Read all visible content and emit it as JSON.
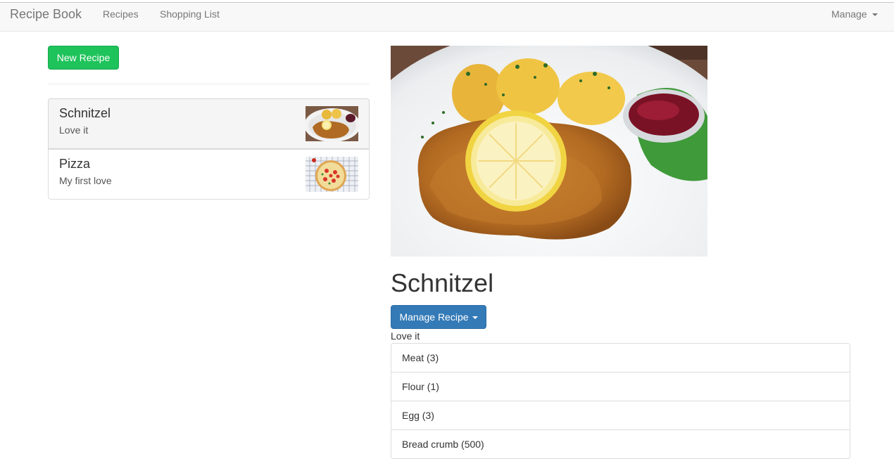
{
  "navbar": {
    "brand": "Recipe Book",
    "links": [
      "Recipes",
      "Shopping List"
    ],
    "manage": "Manage"
  },
  "sidebar": {
    "new_recipe_label": "New Recipe",
    "recipes": [
      {
        "name": "Schnitzel",
        "description": "Love it",
        "active": true,
        "image": "schnitzel-thumbnail"
      },
      {
        "name": "Pizza",
        "description": "My first love",
        "active": false,
        "image": "pizza-thumbnail"
      }
    ]
  },
  "detail": {
    "image": "schnitzel-photo",
    "title": "Schnitzel",
    "manage_label": "Manage Recipe",
    "description": "Love it",
    "ingredients": [
      "Meat (3)",
      "Flour (1)",
      "Egg (3)",
      "Bread crumb (500)"
    ]
  },
  "colors": {
    "success": "#1fc35b",
    "primary": "#337ab7",
    "navbar_bg": "#f8f8f8"
  }
}
